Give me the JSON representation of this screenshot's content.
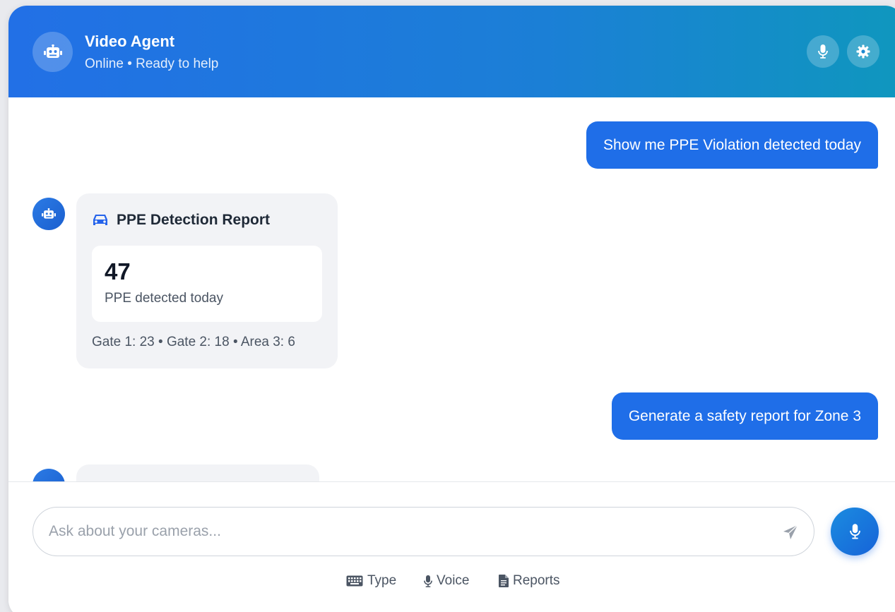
{
  "header": {
    "title": "Video Agent",
    "subtitle": "Online • Ready to help",
    "icons": {
      "avatar": "robot-icon",
      "mic": "microphone-icon",
      "settings": "gear-icon"
    }
  },
  "messages": [
    {
      "role": "user",
      "text": "Show me PPE Violation detected today"
    },
    {
      "role": "bot",
      "card": {
        "icon": "car-icon",
        "title": "PPE Detection Report",
        "stat_value": "47",
        "stat_label": "PPE detected today",
        "breakdown": "Gate 1: 23 • Gate 2: 18 • Area 3: 6"
      }
    },
    {
      "role": "user",
      "text": "Generate a safety report for Zone 3"
    },
    {
      "role": "bot",
      "partial": true
    }
  ],
  "composer": {
    "placeholder": "Ask about your cameras...",
    "send_icon": "send-icon",
    "voice_icon": "microphone-icon"
  },
  "modes": [
    {
      "icon": "keyboard-icon",
      "label": "Type"
    },
    {
      "icon": "microphone-icon",
      "label": "Voice"
    },
    {
      "icon": "document-icon",
      "label": "Reports"
    }
  ],
  "colors": {
    "header_gradient_start": "#2270e6",
    "header_gradient_end": "#0f97be",
    "user_bubble": "#1f6ee8",
    "bot_card": "#f2f3f6"
  }
}
